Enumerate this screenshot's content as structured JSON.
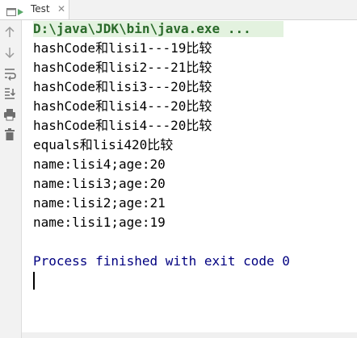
{
  "tab": {
    "label": "Test",
    "close_glyph": "✕",
    "icon": "run-app-icon"
  },
  "toolbar": {
    "items": [
      {
        "icon": "up-arrow-icon"
      },
      {
        "icon": "down-arrow-icon"
      },
      {
        "icon": "soft-wrap-icon"
      },
      {
        "icon": "scroll-to-end-icon"
      },
      {
        "icon": "print-icon"
      },
      {
        "icon": "trash-icon"
      }
    ]
  },
  "console": {
    "command": "D:\\java\\JDK\\bin\\java.exe ...",
    "lines": [
      "hashCode和lisi1---19比较",
      "hashCode和lisi2---21比较",
      "hashCode和lisi3---20比较",
      "hashCode和lisi4---20比较",
      "hashCode和lisi4---20比较",
      "equals和lisi420比较",
      "name:lisi4;age:20",
      "name:lisi3;age:20",
      "name:lisi2;age:21",
      "name:lisi1;age:19"
    ],
    "exit_message": "Process finished with exit code 0"
  },
  "colors": {
    "command_text": "#2a6a2a",
    "command_bg": "#e3f2df",
    "exit_text": "#000080"
  }
}
